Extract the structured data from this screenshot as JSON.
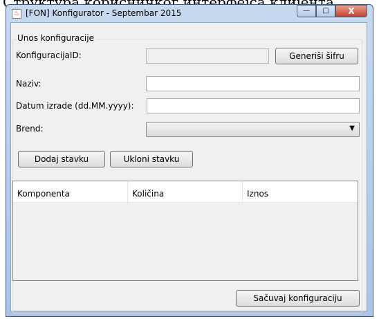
{
  "background_text": "Структура корисничког интерфејса клијента",
  "window": {
    "title": "[FON] Konfigurator - Septembar 2015",
    "controls": {
      "minimize": "—",
      "maximize": "□",
      "close": "X"
    }
  },
  "form": {
    "group_title": "Unos konfiguracije",
    "konfiguracija_id_label": "KonfiguracijaID:",
    "konfiguracija_id_value": "",
    "generate_button": "Generiši šifru",
    "naziv_label": "Naziv:",
    "naziv_value": "",
    "datum_label": "Datum izrade (dd.MM.yyyy):",
    "datum_value": "",
    "brend_label": "Brend:",
    "brend_selected": ""
  },
  "actions": {
    "add_item": "Dodaj stavku",
    "remove_item": "Ukloni stavku",
    "save": "Sačuvaj konfiguraciju"
  },
  "table": {
    "columns": [
      "Komponenta",
      "Količina",
      "Iznos"
    ],
    "rows": []
  }
}
